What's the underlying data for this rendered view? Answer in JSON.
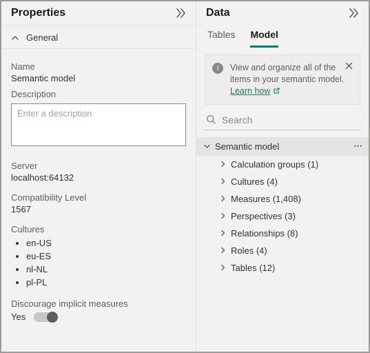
{
  "properties": {
    "title": "Properties",
    "sections": {
      "general": "General"
    },
    "fields": {
      "name": {
        "label": "Name",
        "value": "Semantic model"
      },
      "description": {
        "label": "Description",
        "placeholder": "Enter a description"
      },
      "server": {
        "label": "Server",
        "value": "localhost:64132"
      },
      "compat": {
        "label": "Compatibility Level",
        "value": "1567"
      },
      "cultures": {
        "label": "Cultures",
        "items": [
          "en-US",
          "eu-ES",
          "nl-NL",
          "pl-PL"
        ]
      },
      "discourage": {
        "label": "Discourage implicit measures",
        "value": "Yes",
        "on": true
      }
    }
  },
  "data": {
    "title": "Data",
    "tabs": [
      "Tables",
      "Model"
    ],
    "active_tab": "Model",
    "tip": {
      "text": "View and organize all of the items in your semantic model.",
      "link": "Learn how"
    },
    "search": {
      "placeholder": "Search"
    },
    "tree": {
      "root": "Semantic model",
      "items": [
        "Calculation groups (1)",
        "Cultures (4)",
        "Measures (1,408)",
        "Perspectives (3)",
        "Relationships (8)",
        "Roles (4)",
        "Tables (12)"
      ]
    }
  }
}
